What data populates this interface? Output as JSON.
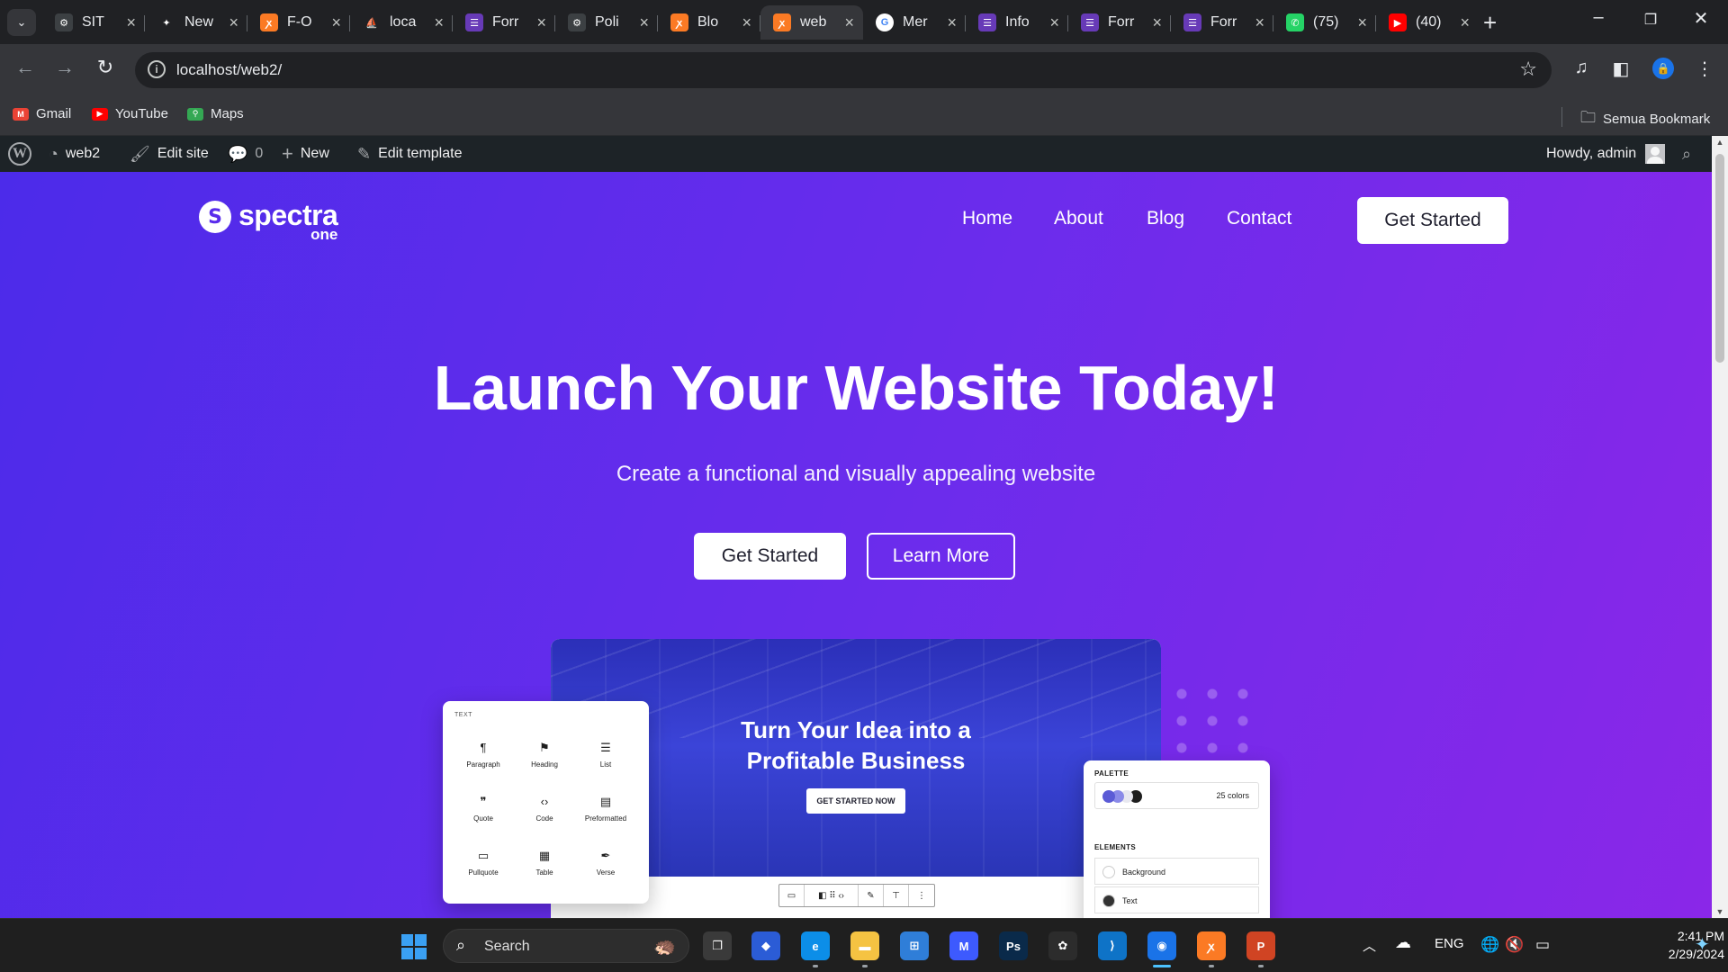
{
  "browser": {
    "tabs": [
      {
        "label": "SIT",
        "icon": "gear-icon",
        "color": "#3c4043",
        "glyph": "⚙",
        "active": false
      },
      {
        "label": "New",
        "icon": "sparkle-icon",
        "color": "#202124",
        "glyph": "✦",
        "active": false
      },
      {
        "label": "F-O",
        "icon": "xampp-icon",
        "color": "#fb7a24",
        "glyph": "ꭗ",
        "active": false
      },
      {
        "label": "loca",
        "icon": "phpmyadmin-icon",
        "color": "#202124",
        "glyph": "⛵",
        "active": false
      },
      {
        "label": "Forr",
        "icon": "form-icon",
        "color": "#673ab7",
        "glyph": "☰",
        "active": false
      },
      {
        "label": "Poli",
        "icon": "gear-icon",
        "color": "#3c4043",
        "glyph": "⚙",
        "active": false
      },
      {
        "label": "Blo",
        "icon": "xampp-icon",
        "color": "#fb7a24",
        "glyph": "ꭗ",
        "active": false
      },
      {
        "label": "web",
        "icon": "xampp-icon",
        "color": "#fb7a24",
        "glyph": "ꭗ",
        "active": true
      },
      {
        "label": "Mer",
        "icon": "google-icon",
        "color": "#ffffff",
        "glyph": "G",
        "active": false
      },
      {
        "label": "Info",
        "icon": "form-icon",
        "color": "#673ab7",
        "glyph": "☰",
        "active": false
      },
      {
        "label": "Forr",
        "icon": "form-icon",
        "color": "#673ab7",
        "glyph": "☰",
        "active": false
      },
      {
        "label": "Forr",
        "icon": "form-icon",
        "color": "#673ab7",
        "glyph": "☰",
        "active": false
      },
      {
        "label": "(75)",
        "icon": "whatsapp-icon",
        "color": "#25d366",
        "glyph": "✆",
        "active": false
      },
      {
        "label": "(40)",
        "icon": "youtube-icon",
        "color": "#ff0000",
        "glyph": "▶",
        "active": false
      }
    ],
    "new_tab": "+",
    "url": "localhost/web2/",
    "bookmarks": [
      {
        "label": "Gmail",
        "icon": "gmail-icon",
        "color": "#ea4335",
        "glyph": "M"
      },
      {
        "label": "YouTube",
        "icon": "youtube-icon",
        "color": "#ff0000",
        "glyph": "▶"
      },
      {
        "label": "Maps",
        "icon": "maps-icon",
        "color": "#34a853",
        "glyph": "⚲"
      }
    ],
    "all_bookmarks": "Semua Bookmark"
  },
  "wp_admin_bar": {
    "site_name": "web2",
    "edit_site": "Edit site",
    "comments_count": "0",
    "new": "New",
    "edit_template": "Edit template",
    "howdy": "Howdy, admin"
  },
  "site": {
    "logo_main": "spectra",
    "logo_sub": "one",
    "nav": [
      "Home",
      "About",
      "Blog",
      "Contact"
    ],
    "nav_cta": "Get Started",
    "hero_title": "Launch Your Website Today!",
    "hero_subtitle": "Create a functional and visually appealing website",
    "primary_button": "Get Started",
    "secondary_button": "Learn More",
    "brand_gradient": [
      "#4c2bea",
      "#8a27e8"
    ]
  },
  "mockup": {
    "title_line1": "Turn Your Idea into a",
    "title_line2": "Profitable Business",
    "button": "GET STARTED NOW",
    "blocks_caption": "TEXT",
    "blocks": [
      {
        "label": "Paragraph",
        "icon": "paragraph-icon",
        "glyph": "¶"
      },
      {
        "label": "Heading",
        "icon": "heading-icon",
        "glyph": "⚑"
      },
      {
        "label": "List",
        "icon": "list-icon",
        "glyph": "☰"
      },
      {
        "label": "Quote",
        "icon": "quote-icon",
        "glyph": "❞"
      },
      {
        "label": "Code",
        "icon": "code-icon",
        "glyph": "‹›"
      },
      {
        "label": "Preformatted",
        "icon": "preformatted-icon",
        "glyph": "▤"
      },
      {
        "label": "Pullquote",
        "icon": "pullquote-icon",
        "glyph": "▭"
      },
      {
        "label": "Table",
        "icon": "table-icon",
        "glyph": "▦"
      },
      {
        "label": "Verse",
        "icon": "verse-icon",
        "glyph": "✒"
      }
    ],
    "palette_caption": "PALETTE",
    "palette_count": "25 colors",
    "palette_colors": [
      "#5b5bd6",
      "#8a8ae8",
      "#e8e8f0",
      "#1e1e1e"
    ],
    "elements_caption": "ELEMENTS",
    "elements": [
      {
        "label": "Background",
        "color": "#ffffff"
      },
      {
        "label": "Text",
        "color": "#333333"
      }
    ]
  },
  "taskbar": {
    "search_placeholder": "Search",
    "language": "ENG",
    "time": "2:41 PM",
    "date": "2/29/2024",
    "apps": [
      {
        "name": "task-view-icon",
        "color": "#3a3a3a",
        "glyph": "❐",
        "state": ""
      },
      {
        "name": "copilot-icon",
        "color": "#2b5cd6",
        "glyph": "◆",
        "state": ""
      },
      {
        "name": "edge-icon",
        "color": "#0c8ee8",
        "glyph": "e",
        "state": "running"
      },
      {
        "name": "file-explorer-icon",
        "color": "#f5c342",
        "glyph": "▬",
        "state": "running"
      },
      {
        "name": "microsoft-store-icon",
        "color": "#2f7ed8",
        "glyph": "⊞",
        "state": ""
      },
      {
        "name": "mathpix-icon",
        "color": "#3d5afe",
        "glyph": "M",
        "state": ""
      },
      {
        "name": "photoshop-icon",
        "color": "#0a2a4a",
        "glyph": "Ps",
        "state": ""
      },
      {
        "name": "figma-icon",
        "color": "#2c2c2c",
        "glyph": "✿",
        "state": ""
      },
      {
        "name": "vscode-icon",
        "color": "#0e73c7",
        "glyph": "⟩",
        "state": ""
      },
      {
        "name": "chrome-icon",
        "color": "#1a73e8",
        "glyph": "◉",
        "state": "active"
      },
      {
        "name": "xampp-icon",
        "color": "#fb7a24",
        "glyph": "ꭗ",
        "state": "running"
      },
      {
        "name": "powerpoint-icon",
        "color": "#d04423",
        "glyph": "P",
        "state": "running"
      }
    ]
  }
}
